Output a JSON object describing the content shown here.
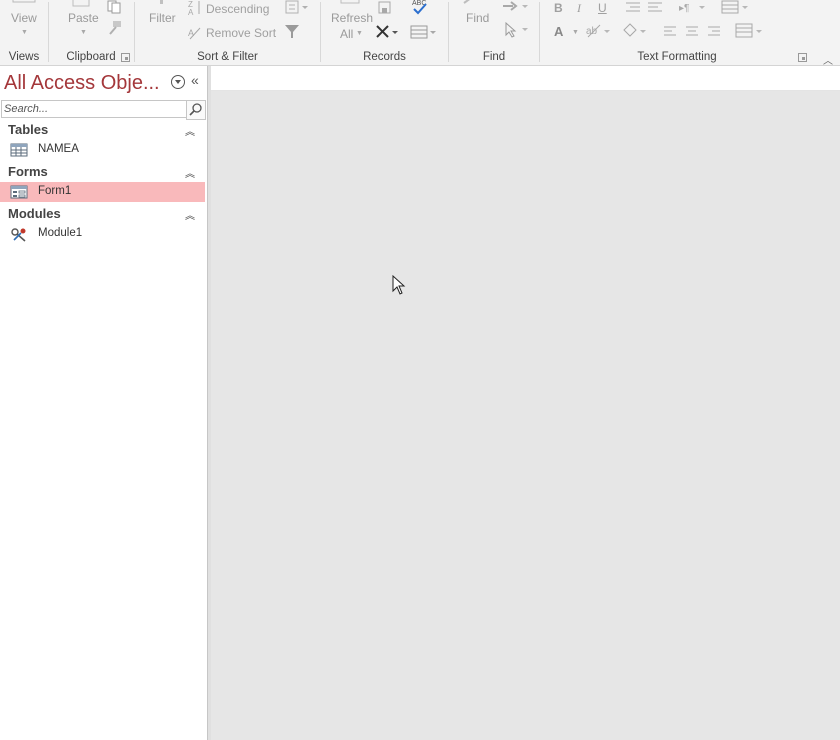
{
  "ribbon": {
    "views": {
      "label": "Views",
      "view_button": "View"
    },
    "clipboard": {
      "label": "Clipboard",
      "paste_button": "Paste"
    },
    "sort_filter": {
      "label": "Sort & Filter",
      "filter_button": "Filter",
      "descending_button": "Descending",
      "remove_sort_button": "Remove Sort"
    },
    "records": {
      "label": "Records",
      "refresh_line1": "Refresh",
      "refresh_line2": "All"
    },
    "find": {
      "label": "Find",
      "find_button": "Find"
    },
    "text_formatting": {
      "label": "Text Formatting",
      "bold": "B",
      "italic": "I",
      "underline": "U",
      "font_color": "A"
    }
  },
  "nav": {
    "title": "All Access Obje...",
    "search_placeholder": "Search...",
    "categories": [
      {
        "label": "Tables",
        "items": [
          {
            "label": "NAMEA",
            "icon": "table-icon"
          }
        ]
      },
      {
        "label": "Forms",
        "items": [
          {
            "label": "Form1",
            "icon": "form-icon",
            "selected": true
          }
        ]
      },
      {
        "label": "Modules",
        "items": [
          {
            "label": "Module1",
            "icon": "module-icon"
          }
        ]
      }
    ]
  },
  "colors": {
    "nav_title": "#a4373a",
    "selected_item": "#f9b9bb",
    "workspace": "#e6e6e6",
    "ribbon": "#f3f3f3"
  }
}
